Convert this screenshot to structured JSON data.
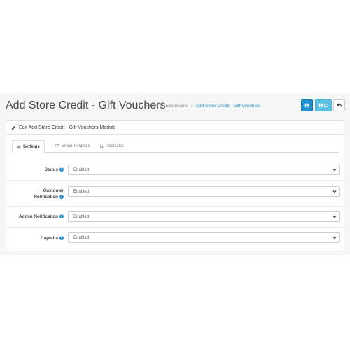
{
  "header": {
    "title": "Add Store Credit - Gift Vouchers",
    "breadcrumb": [
      {
        "label": "Home"
      },
      {
        "label": "Extensions"
      },
      {
        "label": "Add Store Credit - Gift Vouchers"
      }
    ],
    "breadcrumb_separator": "»",
    "buttons": {
      "save_icon": "save-icon",
      "save_stay_icon": "save-and-stay-icon",
      "back_icon": "back-arrow-icon"
    }
  },
  "panel": {
    "heading_icon": "pencil-icon",
    "heading": "Edit Add Store Credit - Gift Vouchers Module"
  },
  "tabs": [
    {
      "label": "Settings",
      "icon": "gear-icon",
      "active": true
    },
    {
      "label": "Email Template",
      "icon": "envelope-icon",
      "active": false
    },
    {
      "label": "Statistics",
      "icon": "bar-chart-icon",
      "active": false
    }
  ],
  "form": {
    "fields": [
      {
        "label": "Status",
        "value": "Enabled"
      },
      {
        "label_line1": "Customer",
        "label_line2": "Notification",
        "value": "Enabled"
      },
      {
        "label": "Admin Notification",
        "value": "Enabled"
      },
      {
        "label": "Captcha",
        "value": "Enabled"
      }
    ],
    "help_icon": "question-circle-icon"
  },
  "colors": {
    "primary": "#1e91cf",
    "info": "#5bc0de",
    "background": "#f6f6f6"
  }
}
